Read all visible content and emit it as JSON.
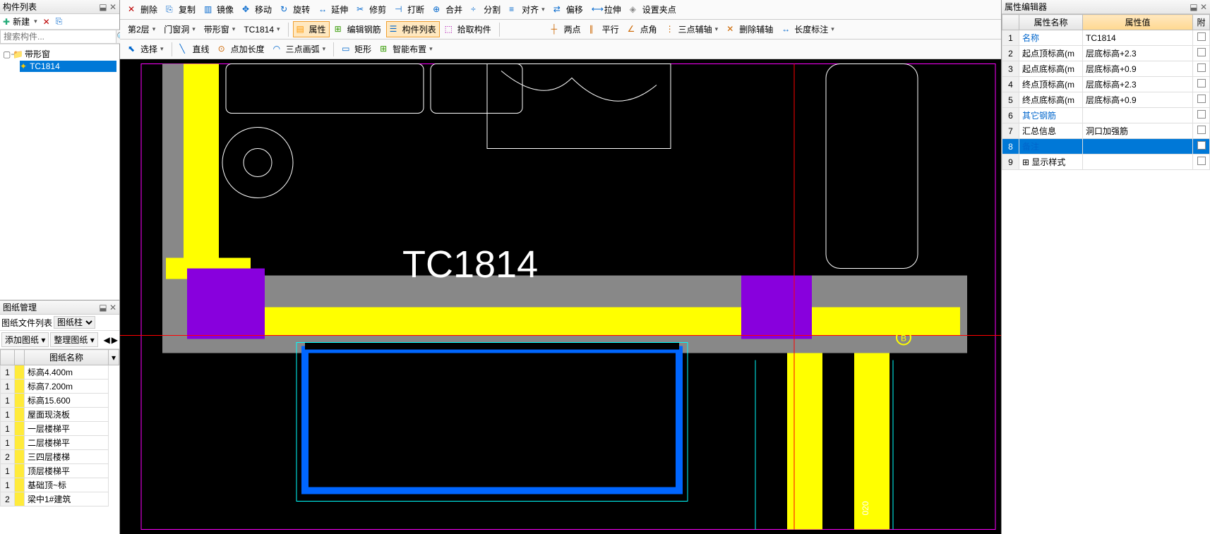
{
  "left": {
    "component_panel_title": "构件列表",
    "new_label": "新建",
    "search_placeholder": "搜索构件...",
    "tree_root": "带形窗",
    "tree_child": "TC1814",
    "drawing_panel_title": "图纸管理",
    "drawing_file_list_label": "图纸文件列表",
    "drawing_filter": "图纸柱",
    "add_drawing_label": "添加图纸",
    "organize_drawing_label": "整理图纸",
    "drawing_name_header": "图纸名称",
    "drawings": [
      {
        "num": "1",
        "name": "标高4.400m"
      },
      {
        "num": "1",
        "name": "标高7.200m"
      },
      {
        "num": "1",
        "name": "标高15.600"
      },
      {
        "num": "1",
        "name": "屋面现浇板"
      },
      {
        "num": "1",
        "name": "一层楼梯平"
      },
      {
        "num": "1",
        "name": "二层楼梯平"
      },
      {
        "num": "2",
        "name": "三四层楼梯"
      },
      {
        "num": "1",
        "name": "顶层楼梯平"
      },
      {
        "num": "1",
        "name": "基础顶~标"
      },
      {
        "num": "2",
        "name": "梁中1#建筑"
      }
    ]
  },
  "toolbar1": {
    "delete": "删除",
    "copy": "复制",
    "mirror": "镜像",
    "move": "移动",
    "rotate": "旋转",
    "extend": "延伸",
    "trim": "修剪",
    "break": "打断",
    "merge": "合并",
    "split": "分割",
    "align": "对齐",
    "offset": "偏移",
    "stretch": "拉伸",
    "grip": "设置夹点"
  },
  "toolbar2": {
    "layer": "第2层",
    "door": "门窗洞",
    "strip": "带形窗",
    "code": "TC1814",
    "prop": "属性",
    "edit_rebar": "编辑钢筋",
    "comp_list": "构件列表",
    "pick": "拾取构件",
    "two_pt": "两点",
    "parallel": "平行",
    "angle": "点角",
    "three_aux": "三点辅轴",
    "del_aux": "删除辅轴",
    "dim": "长度标注"
  },
  "toolbar3": {
    "select": "选择",
    "line": "直线",
    "point": "点加长度",
    "arc": "三点画弧",
    "rect": "矩形",
    "smart": "智能布置"
  },
  "canvas": {
    "main_label": "TC1814",
    "dim_label": "020"
  },
  "right": {
    "panel_title": "属性编辑器",
    "name_header": "属性名称",
    "value_header": "属性值",
    "attach_header": "附",
    "rows": [
      {
        "n": "1",
        "name": "名称",
        "value": "TC1814",
        "link": true
      },
      {
        "n": "2",
        "name": "起点顶标高(m",
        "value": "层底标高+2.3"
      },
      {
        "n": "3",
        "name": "起点底标高(m",
        "value": "层底标高+0.9"
      },
      {
        "n": "4",
        "name": "终点顶标高(m",
        "value": "层底标高+2.3"
      },
      {
        "n": "5",
        "name": "终点底标高(m",
        "value": "层底标高+0.9"
      },
      {
        "n": "6",
        "name": "其它钢筋",
        "value": "",
        "link": true
      },
      {
        "n": "7",
        "name": "汇总信息",
        "value": "洞口加强筋"
      },
      {
        "n": "8",
        "name": "备注",
        "value": "",
        "link": true,
        "selected": true
      },
      {
        "n": "9",
        "name": "显示样式",
        "value": "",
        "expand": true
      }
    ]
  }
}
